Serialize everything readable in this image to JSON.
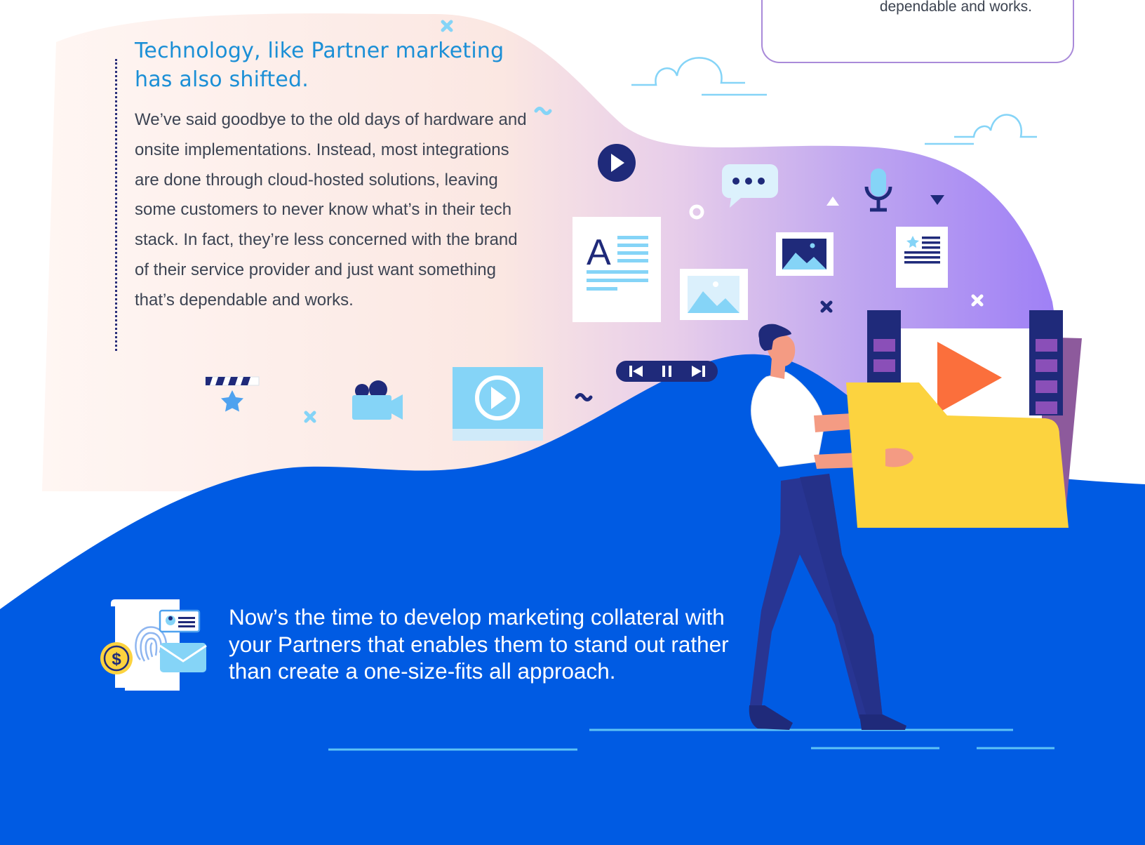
{
  "top_card": {
    "text": "dependable and works."
  },
  "section": {
    "heading": "Technology, like Partner marketing has also shifted.",
    "body": "We’ve said goodbye to the old days of hardware and onsite implementations. Instead, most integrations are done through cloud-hosted solutions, leaving some customers to never know what’s in their tech stack. In fact, they’re less concerned with the brand of their service provider and just want something that’s dependable and works."
  },
  "callout": {
    "text": "Now’s the time to develop marketing collateral with your Partners that enables them to stand out rather than create a one-size-fits all approach.",
    "icon": "document-fingerprint-dollar-icon"
  },
  "media_controls": [
    "previous-icon",
    "pause-icon",
    "next-icon"
  ],
  "colors": {
    "ocean_blue": "#005be3",
    "heading_blue": "#1b8fd6",
    "body_text": "#3d4453",
    "navy": "#1f2a7a",
    "light_blue": "#85d4f7",
    "folder_yellow": "#fcd33f",
    "play_orange": "#fb6f3c",
    "purple_accent": "#a98ad9"
  }
}
